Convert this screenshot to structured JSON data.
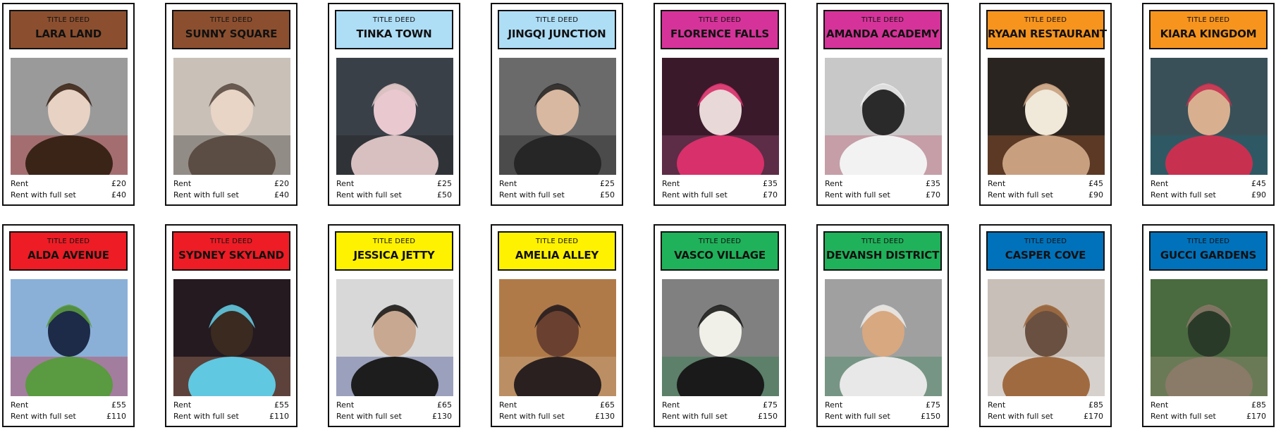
{
  "cards": [
    {
      "deed": "TITLE DEED",
      "name": "LARA LAND",
      "rent_label": "Rent",
      "rent": "£20",
      "full_label": "Rent with full set",
      "full": "£40",
      "color": "#8B4F2F",
      "text_color": "#111111",
      "photo_desc": "person-cowboy-hat-photo"
    },
    {
      "deed": "TITLE DEED",
      "name": "SUNNY SQUARE",
      "rent_label": "Rent",
      "rent": "£20",
      "full_label": "Rent with full set",
      "full": "£40",
      "color": "#8B4F2F",
      "text_color": "#111111",
      "photo_desc": "person-eating-photo"
    },
    {
      "deed": "TITLE DEED",
      "name": "TINKA TOWN",
      "rent_label": "Rent",
      "rent": "£25",
      "full_label": "Rent with full set",
      "full": "£50",
      "color": "#AEDDF6",
      "text_color": "#111111",
      "photo_desc": "person-with-poster-photo"
    },
    {
      "deed": "TITLE DEED",
      "name": "JINGQI JUNCTION",
      "rent_label": "Rent",
      "rent": "£25",
      "full_label": "Rent with full set",
      "full": "£50",
      "color": "#AEDDF6",
      "text_color": "#111111",
      "photo_desc": "person-closeup-photo"
    },
    {
      "deed": "TITLE DEED",
      "name": "FLORENCE FALLS",
      "rent_label": "Rent",
      "rent": "£35",
      "full_label": "Rent with full set",
      "full": "£70",
      "color": "#D6339A",
      "text_color": "#111111",
      "photo_desc": "dancers-stage-photo"
    },
    {
      "deed": "TITLE DEED",
      "name": "AMANDA ACADEMY",
      "rent_label": "Rent",
      "rent": "£35",
      "full_label": "Rent with full set",
      "full": "£70",
      "color": "#D6339A",
      "text_color": "#111111",
      "photo_desc": "person-at-lectern-photo"
    },
    {
      "deed": "TITLE DEED",
      "name": "RYAAN RESTAURANT",
      "rent_label": "Rent",
      "rent": "£45",
      "full_label": "Rent with full set",
      "full": "£90",
      "color": "#F7941E",
      "text_color": "#111111",
      "photo_desc": "person-restaurant-photo"
    },
    {
      "deed": "TITLE DEED",
      "name": "KIARA KINGDOM",
      "rent_label": "Rent",
      "rent": "£45",
      "full_label": "Rent with full set",
      "full": "£90",
      "color": "#F7941E",
      "text_color": "#111111",
      "photo_desc": "group-party-photo"
    },
    {
      "deed": "TITLE DEED",
      "name": "ALDA AVENUE",
      "rent_label": "Rent",
      "rent": "£55",
      "full_label": "Rent with full set",
      "full": "£110",
      "color": "#EE1C25",
      "text_color": "#111111",
      "photo_desc": "person-by-no-fishing-sign-photo"
    },
    {
      "deed": "TITLE DEED",
      "name": "SYDNEY SKYLAND",
      "rent_label": "Rent",
      "rent": "£55",
      "full_label": "Rent with full set",
      "full": "£110",
      "color": "#EE1C25",
      "text_color": "#111111",
      "photo_desc": "person-ferris-wheel-photo"
    },
    {
      "deed": "TITLE DEED",
      "name": "JESSICA JETTY",
      "rent_label": "Rent",
      "rent": "£65",
      "full_label": "Rent with full set",
      "full": "£130",
      "color": "#FFF200",
      "text_color": "#111111",
      "photo_desc": "person-selfie-photo"
    },
    {
      "deed": "TITLE DEED",
      "name": "AMELIA ALLEY",
      "rent_label": "Rent",
      "rent": "£65",
      "full_label": "Rent with full set",
      "full": "£130",
      "color": "#FFF200",
      "text_color": "#111111",
      "photo_desc": "person-glasses-photo"
    },
    {
      "deed": "TITLE DEED",
      "name": "VASCO VILLAGE",
      "rent_label": "Rent",
      "rent": "£75",
      "full_label": "Rent with full set",
      "full": "£150",
      "color": "#1FB25A",
      "text_color": "#111111",
      "photo_desc": "surfboard-photo"
    },
    {
      "deed": "TITLE DEED",
      "name": "DEVANSH DISTRICT",
      "rent_label": "Rent",
      "rent": "£75",
      "full_label": "Rent with full set",
      "full": "£150",
      "color": "#1FB25A",
      "text_color": "#111111",
      "photo_desc": "person-paper-hat-photo"
    },
    {
      "deed": "TITLE DEED",
      "name": "CASPER COVE",
      "rent_label": "Rent",
      "rent": "£85",
      "full_label": "Rent with full set",
      "full": "£170",
      "color": "#0072BB",
      "text_color": "#111111",
      "photo_desc": "cat-photo"
    },
    {
      "deed": "TITLE DEED",
      "name": "GUCCI GARDENS",
      "rent_label": "Rent",
      "rent": "£85",
      "full_label": "Rent with full set",
      "full": "£170",
      "color": "#0072BB",
      "text_color": "#111111",
      "photo_desc": "cat-plants-photo"
    }
  ]
}
